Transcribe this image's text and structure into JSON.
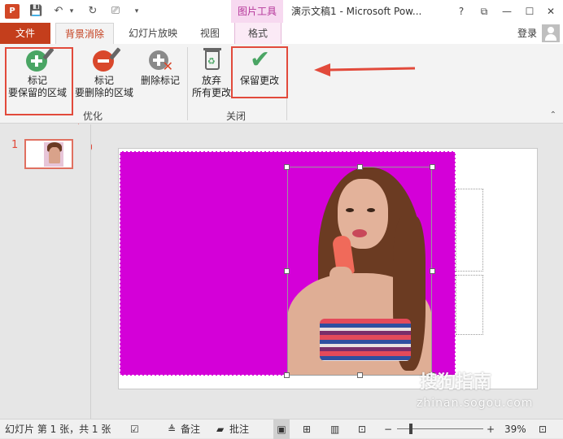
{
  "app": {
    "title": "演示文稿1 - Microsoft Pow...",
    "context_group": "图片工具",
    "accent_color": "#c43e1c",
    "context_color": "#b5379a"
  },
  "title_controls": {
    "help": "?",
    "ribbon_display": "⧉",
    "minimize": "—",
    "maximize": "☐",
    "close": "✕"
  },
  "tabs": [
    {
      "label": "文件"
    },
    {
      "label": "背景消除"
    },
    {
      "label": "幻灯片放映"
    },
    {
      "label": "视图"
    },
    {
      "label": "格式"
    }
  ],
  "login": "登录",
  "ribbon": {
    "mark_keep": {
      "line1": "标记",
      "line2": "要保留的区域"
    },
    "mark_remove": {
      "line1": "标记",
      "line2": "要删除的区域"
    },
    "delete_mark": {
      "line1": "删除标记"
    },
    "discard": {
      "line1": "放弃",
      "line2": "所有更改"
    },
    "keep_changes": {
      "line1": "保留更改"
    },
    "group_optimize": "优化",
    "group_close": "关闭"
  },
  "slides_pane": {
    "slide_number": "1"
  },
  "status": {
    "slide_info": "幻灯片 第 1 张，共 1 张",
    "notes": "备注",
    "comments": "批注",
    "zoom": "39%",
    "zoom_minus": "−",
    "zoom_plus": "+"
  },
  "watermark": {
    "main": "搜狗指南",
    "sub": "zhinan.sogou.com"
  },
  "annotations": {
    "highlight_color": "#e24a3b"
  }
}
